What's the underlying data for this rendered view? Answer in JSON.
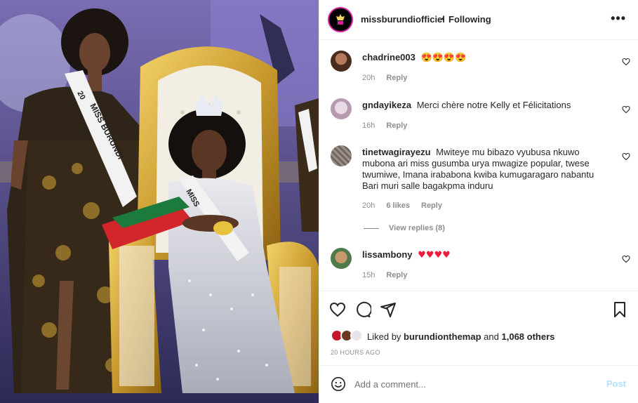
{
  "post": {
    "author": "missburundiofficiel",
    "separator": "•",
    "follow_status": "Following",
    "more_icon": "more-horizontal-icon",
    "photo": {
      "sash_left": "MISS BURUNDI",
      "sash_right": "MISS",
      "sash_year_left": "20"
    }
  },
  "comments": [
    {
      "username": "chadrine003",
      "text": "😍😍😍😍",
      "time": "20h",
      "likes": "",
      "reply": "Reply"
    },
    {
      "username": "gndayikeza",
      "text": "Merci chère notre Kelly et Félicitations",
      "time": "16h",
      "likes": "",
      "reply": "Reply"
    },
    {
      "username": "tinetwagirayezu",
      "text": "Mwiteye mu bibazo vyubusa nkuwo mubona ari miss gusumba urya mwagize popular, twese twumiwe, Imana irababona kwiba kumugaragaro nabantu Bari muri salle bagakpma induru",
      "time": "20h",
      "likes": "6 likes",
      "reply": "Reply",
      "view_replies": "View replies (8)"
    },
    {
      "username": "lissambony",
      "text": "♥♥♥♥",
      "time": "15h",
      "likes": "",
      "reply": "Reply"
    }
  ],
  "likes": {
    "prefix": "Liked by",
    "user": "burundionthemap",
    "conjunction": "and",
    "others": "1,068 others"
  },
  "timestamp": "20 HOURS AGO",
  "add_comment": {
    "placeholder": "Add a comment...",
    "post_label": "Post"
  },
  "colors": {
    "heart_red": "#ed1c3c",
    "post_disabled": "#b2dffc",
    "meta_gray": "#8e8e8e",
    "story_ring": "#d6249f"
  }
}
